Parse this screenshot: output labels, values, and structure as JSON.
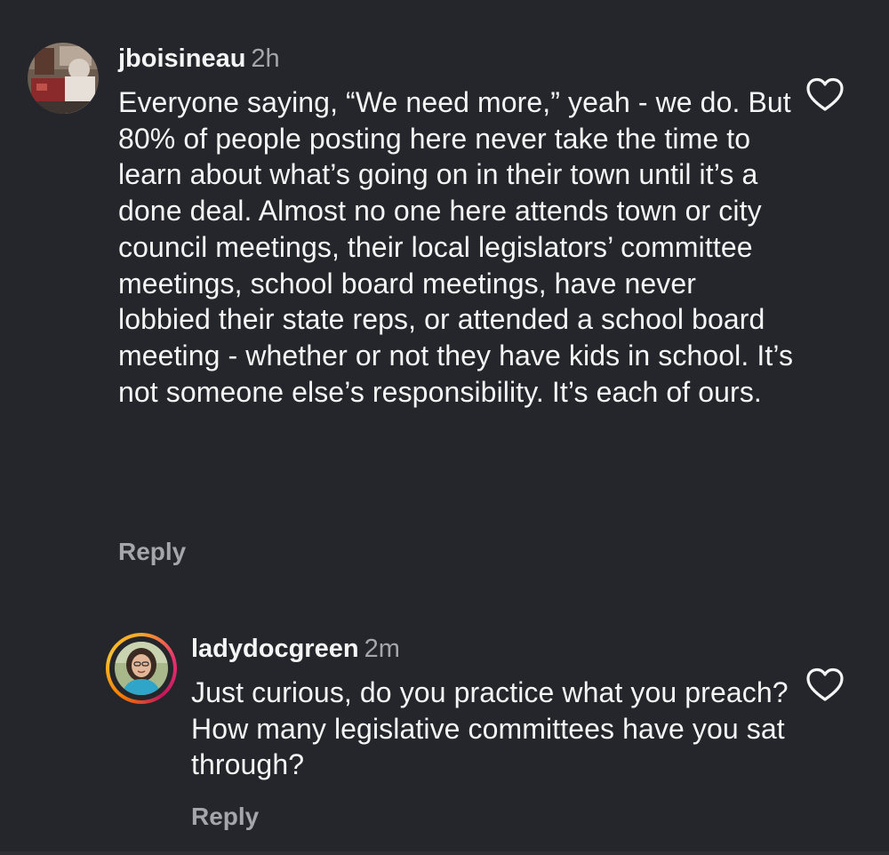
{
  "comments": [
    {
      "username": "jboisineau",
      "time": "2h",
      "text": "Everyone saying, “We need more,” yeah - we do. But 80% of people posting here never take the time to learn about what’s going on in their town until it’s a done deal. Almost no one here attends town or city council meetings, their local legislators’ committee meetings, school board meetings, have never lobbied their state reps, or attended a school board meeting - whether or not they have kids in school. It’s not someone else’s responsibility. It’s each of ours.",
      "reply_label": "Reply",
      "like_icon": "heart-outline-icon"
    },
    {
      "username": "ladydocgreen",
      "time": "2m",
      "text": "Just curious, do you practice what you preach? How many legislative committees have you sat through?",
      "reply_label": "Reply",
      "like_icon": "heart-outline-icon",
      "has_story_ring": true
    }
  ],
  "colors": {
    "background": "#25262b",
    "text": "#f5f5f5",
    "muted": "#a4a6ab"
  }
}
